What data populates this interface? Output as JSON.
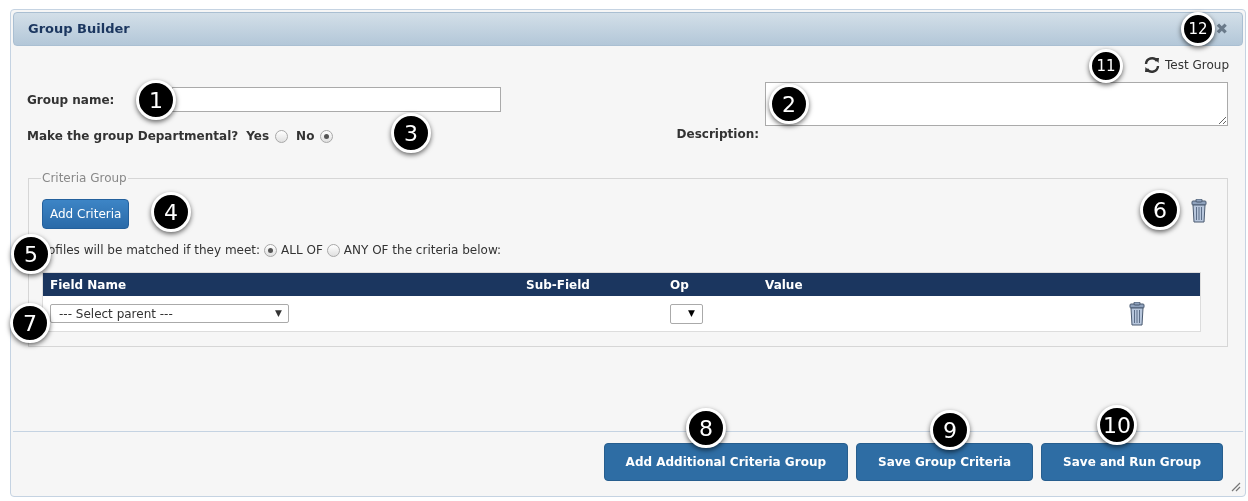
{
  "window": {
    "title": "Group Builder",
    "close": "✖"
  },
  "test_group": {
    "label": "Test Group"
  },
  "group_name": {
    "label": "Group name:"
  },
  "departmental": {
    "label": "Make the group Departmental?",
    "options": [
      {
        "label": "Yes",
        "selected": false
      },
      {
        "label": "No",
        "selected": true
      }
    ]
  },
  "description": {
    "label": "Description:"
  },
  "criteria_group": {
    "legend": "Criteria Group",
    "add_button": "Add Criteria",
    "match_prefix": "ofiles will be matched if they meet:",
    "match_options": [
      {
        "label": "ALL OF",
        "selected": true
      },
      {
        "label": "ANY OF the criteria below:",
        "selected": false
      }
    ],
    "table": {
      "columns": [
        "Field Name",
        "Sub-Field",
        "Op",
        "Value"
      ],
      "rows": [
        {
          "field_name": "--- Select parent ---",
          "field_arrow": "▼",
          "op_arrow": "▼"
        }
      ]
    }
  },
  "buttons": [
    "Add Additional Criteria Group",
    "Save Group Criteria",
    "Save and Run Group"
  ],
  "callouts": [
    "1",
    "2",
    "3",
    "4",
    "5",
    "6",
    "7",
    "8",
    "9",
    "10",
    "11",
    "12"
  ]
}
